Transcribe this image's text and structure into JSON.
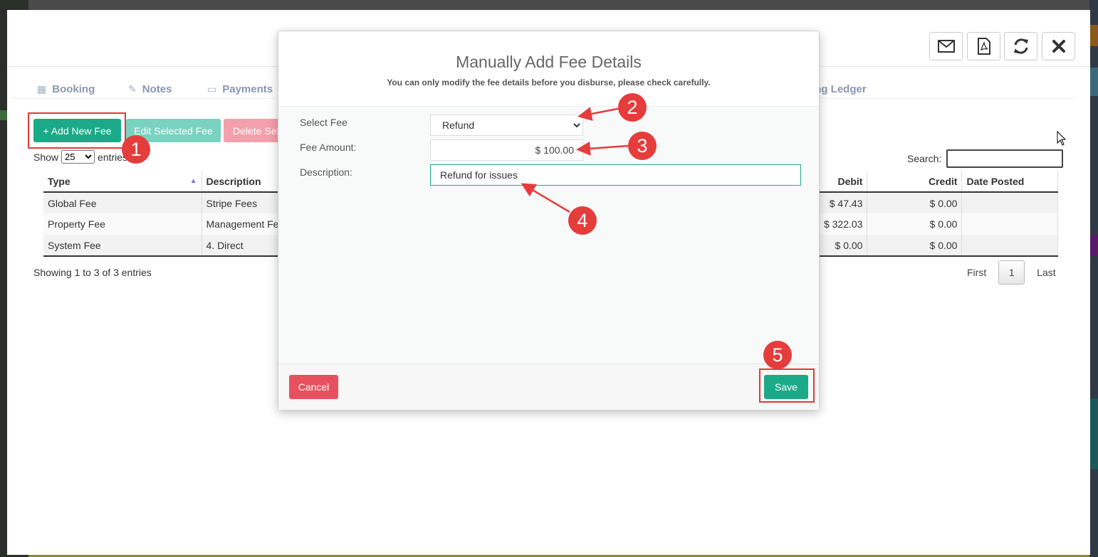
{
  "header_buttons": [
    {
      "name": "email-button",
      "icon": "envelope-icon"
    },
    {
      "name": "pdf-button",
      "icon": "pdf-icon"
    },
    {
      "name": "refresh-button",
      "icon": "refresh-icon"
    },
    {
      "name": "close-button",
      "icon": "close-icon"
    }
  ],
  "tabs": [
    {
      "label": "Booking",
      "icon": "calendar-icon"
    },
    {
      "label": "Notes",
      "icon": "edit-icon"
    },
    {
      "label": "Payments",
      "icon": "credit-card-icon"
    }
  ],
  "tab_ledger_label": "ing Ledger",
  "toolbar": {
    "add_label": "+ Add New Fee",
    "edit_label": "Edit Selected Fee",
    "delete_label": "Delete Sel"
  },
  "show": {
    "prefix": "Show",
    "value": "25",
    "suffix": "entries"
  },
  "search": {
    "label": "Search:",
    "value": ""
  },
  "table": {
    "left_columns": [
      "Type",
      "Description"
    ],
    "right_columns": [
      "Debit",
      "Credit",
      "Date Posted"
    ],
    "rows": [
      {
        "type": "Global Fee",
        "description": "Stripe Fees",
        "debit": "$ 47.43",
        "credit": "$ 0.00",
        "date": ""
      },
      {
        "type": "Property Fee",
        "description": "Management Fe",
        "debit": "$ 322.03",
        "credit": "$ 0.00",
        "date": ""
      },
      {
        "type": "System Fee",
        "description": "4. Direct",
        "debit": "$ 0.00",
        "credit": "$ 0.00",
        "date": ""
      }
    ]
  },
  "footer_info": "Showing 1 to 3 of 3 entries",
  "pager": {
    "first": "First",
    "page": "1",
    "last": "Last"
  },
  "modal": {
    "title": "Manually Add Fee Details",
    "subtitle": "You can only modify the fee details before you disburse, please check carefully.",
    "fields": {
      "select_fee_label": "Select Fee",
      "select_fee_value": "Refund",
      "fee_amount_label": "Fee Amount:",
      "fee_amount_value": "$ 100.00",
      "description_label": "Description:",
      "description_value": "Refund for issues"
    },
    "cancel_label": "Cancel",
    "save_label": "Save"
  },
  "annotations": [
    "1",
    "2",
    "3",
    "4",
    "5"
  ],
  "colors": {
    "primary": "#1aaa88",
    "danger": "#e8505f",
    "annotation": "#e53c3c",
    "tab_text": "#8a96b2"
  }
}
